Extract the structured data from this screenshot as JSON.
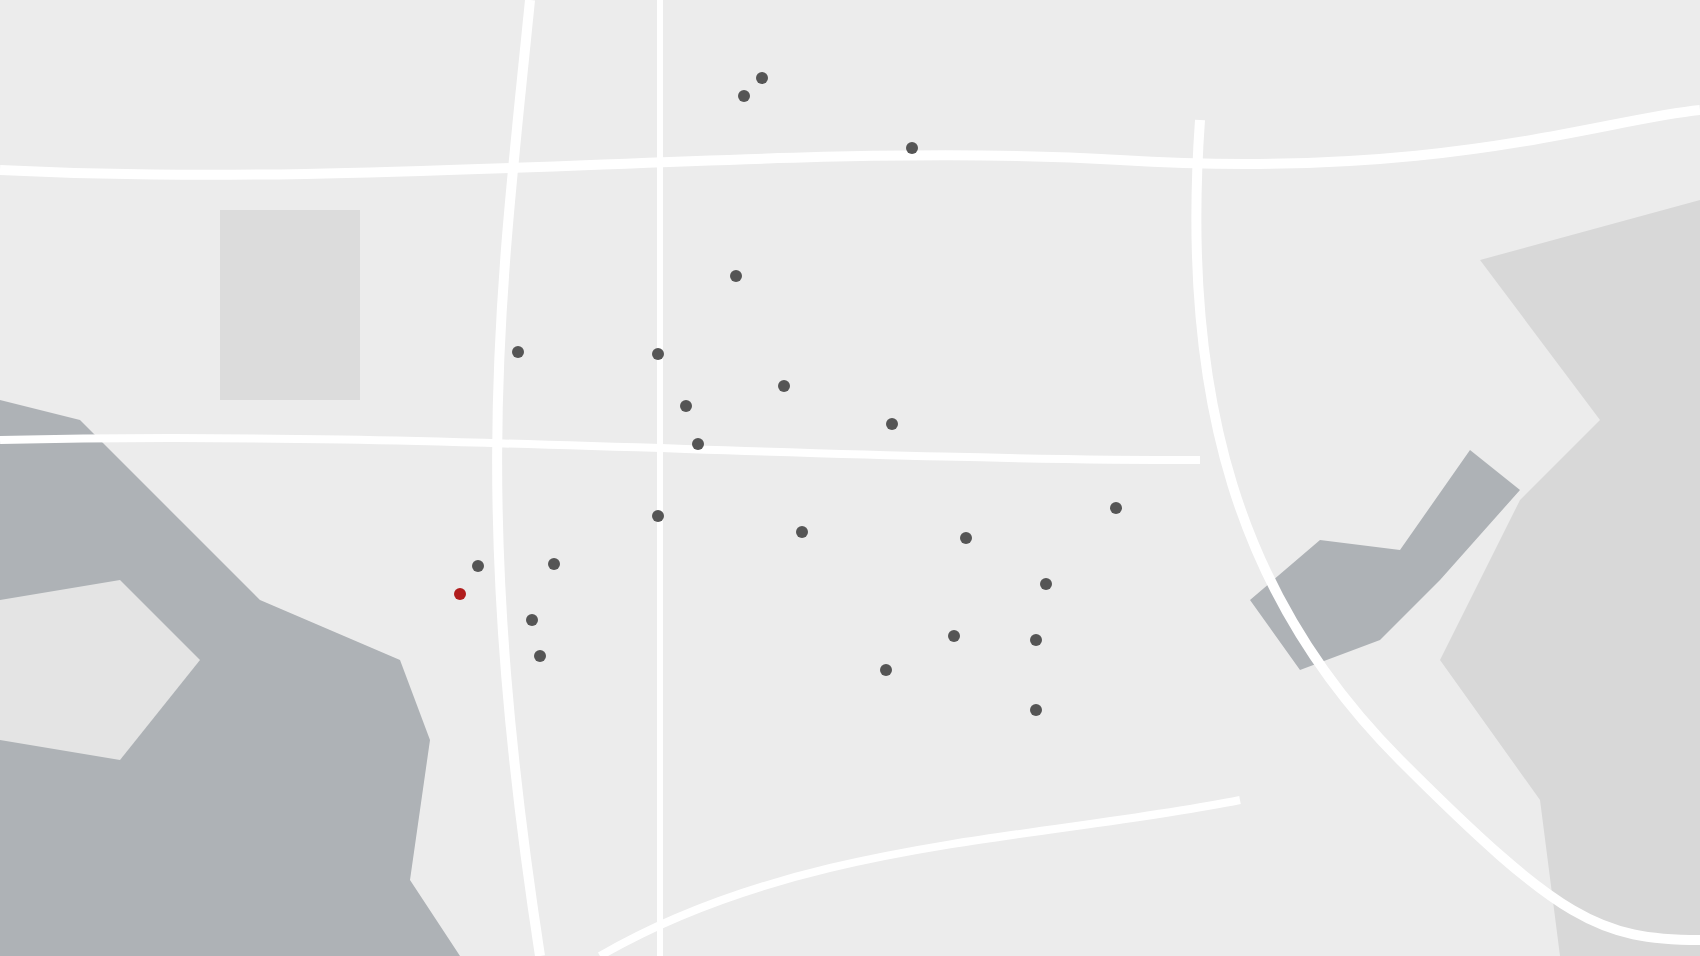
{
  "map": {
    "kind": "picture",
    "markers": [
      {
        "color": "#555555"
      },
      {
        "color": "#555555"
      },
      {
        "color": "#555555"
      },
      {
        "color": "#555555"
      },
      {
        "color": "#555555"
      },
      {
        "color": "#555555"
      },
      {
        "color": "#555555"
      },
      {
        "color": "#555555"
      },
      {
        "color": "#555555"
      },
      {
        "color": "#555555"
      },
      {
        "color": "#555555"
      },
      {
        "color": "#555555"
      },
      {
        "color": "#555555"
      },
      {
        "color": "#555555"
      },
      {
        "color": "#555555"
      },
      {
        "color": "#555555"
      },
      {
        "color": "#555555"
      },
      {
        "color": "#b01c1c"
      },
      {
        "color": "#555555"
      },
      {
        "color": "#555555"
      },
      {
        "color": "#555555"
      },
      {
        "color": "#555555"
      },
      {
        "color": "#555555"
      },
      {
        "color": "#555555"
      }
    ]
  }
}
